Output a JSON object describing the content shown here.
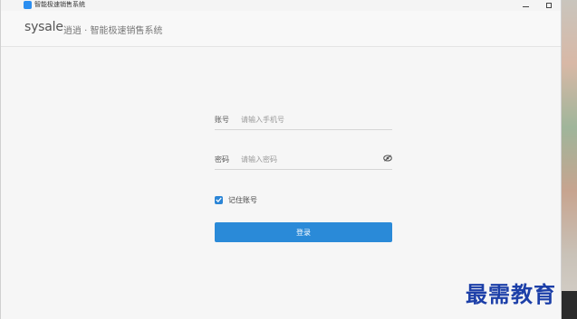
{
  "window": {
    "title": "智能极速销售系统",
    "minimize_icon": "minimize-icon",
    "maximize_icon": "maximize-icon"
  },
  "header": {
    "logo": "sysale",
    "subtitle": "逍逍 · 智能极速销售系统"
  },
  "login": {
    "account_label": "账号",
    "account_placeholder": "请输入手机号",
    "account_value": "",
    "password_label": "密码",
    "password_placeholder": "请输入密码",
    "password_value": "",
    "password_toggle_icon": "eye-icon",
    "remember_label": "记住账号",
    "remember_checked": true,
    "submit_label": "登录"
  },
  "watermark": {
    "text": "最需教育"
  },
  "colors": {
    "accent": "#2a8ad8",
    "watermark": "#1c3fa8"
  }
}
